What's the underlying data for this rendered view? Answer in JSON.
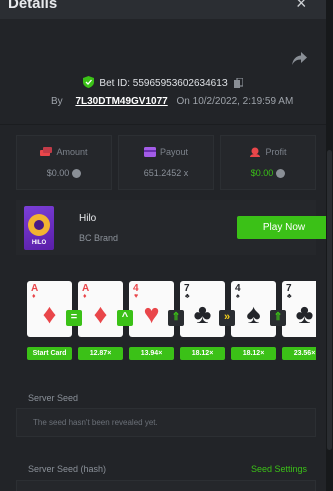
{
  "header": {
    "title": "Details",
    "close": "×"
  },
  "bet": {
    "id_label": "Bet ID:",
    "id": "5596595360263461З",
    "by_label": "By",
    "user": "7L30DTM49GV1077",
    "on_label": "On",
    "date": "10/2/2022, 2:19:59 AM"
  },
  "stats": {
    "amount_label": "Amount",
    "amount_value": "$0.00",
    "payout_label": "Payout",
    "payout_value": "651.2452 x",
    "profit_label": "Profit",
    "profit_value": "$0.00"
  },
  "game": {
    "thumb_text": "HILO",
    "name": "Hilo",
    "brand": "BC Brand",
    "play_label": "Play Now"
  },
  "cards": [
    {
      "rank": "A",
      "suit": "♦",
      "color": "#e9464a"
    },
    {
      "rank": "A",
      "suit": "♦",
      "color": "#e9464a"
    },
    {
      "rank": "4",
      "suit": "♥",
      "color": "#e9464a"
    },
    {
      "rank": "7",
      "suit": "♣",
      "color": "#23252a"
    },
    {
      "rank": "4",
      "suit": "♠",
      "color": "#23252a"
    },
    {
      "rank": "7",
      "suit": "♣",
      "color": "#23252a"
    }
  ],
  "arrows": [
    "=",
    "^",
    "⇑",
    "»",
    "⇑"
  ],
  "multipliers": [
    "Start Card",
    "12.87×",
    "13.94×",
    "18.12×",
    "18.12×",
    "23.56×"
  ],
  "seeds": {
    "server_seed_label": "Server Seed",
    "server_seed_value": "The seed hasn't been revealed yet.",
    "hash_label": "Server Seed (hash)",
    "settings_label": "Seed Settings"
  },
  "colors": {
    "accent": "#3bc117",
    "panel": "#222428",
    "background": "#1a1c1f"
  }
}
